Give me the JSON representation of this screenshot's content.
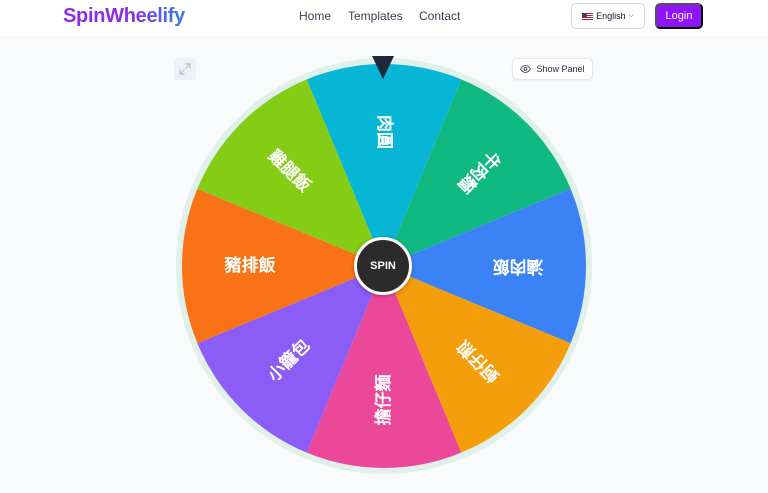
{
  "header": {
    "logo": "SpinWheelify",
    "nav": [
      "Home",
      "Templates",
      "Contact"
    ],
    "language": "English",
    "login": "Login"
  },
  "controls": {
    "show_panel": "Show Panel",
    "spin": "SPIN"
  },
  "wheel": {
    "segments": [
      {
        "label": "肉圓",
        "color": "#06b6d4"
      },
      {
        "label": "牛肉麵",
        "color": "#10b981"
      },
      {
        "label": "滷肉飯",
        "color": "#3b82f6"
      },
      {
        "label": "蚵仔煎",
        "color": "#f59e0b"
      },
      {
        "label": "擔仔麵",
        "color": "#ec4899"
      },
      {
        "label": "小籠包",
        "color": "#8b5cf6"
      },
      {
        "label": "豬排飯",
        "color": "#f97316"
      },
      {
        "label": "雞腿飯",
        "color": "#84cc16"
      }
    ]
  },
  "icons": {
    "expand": "expand-icon",
    "eye": "eye-icon",
    "chevron": "chevron-down-icon",
    "flag": "us-flag-icon"
  }
}
